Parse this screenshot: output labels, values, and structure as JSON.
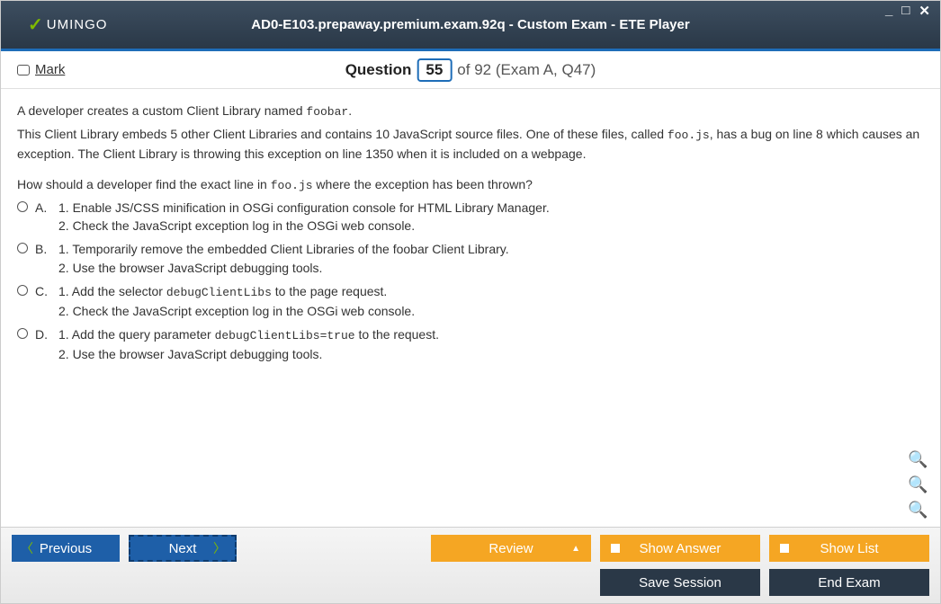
{
  "logo": {
    "brand": "UMINGO"
  },
  "title": "AD0-E103.prepaway.premium.exam.92q - Custom Exam - ETE Player",
  "header": {
    "mark_label": "Mark",
    "question_word": "Question",
    "number": "55",
    "of_text": "of 92 (Exam A, Q47)"
  },
  "question": {
    "line1_a": "A developer creates a custom Client Library named ",
    "line1_code": "foobar",
    "line1_b": ".",
    "line2_a": "This Client Library embeds 5 other Client Libraries and contains 10 JavaScript source files. One of these files, called ",
    "line2_code": "foo.js",
    "line2_b": ", has a bug on line 8 which causes an exception. The Client Library is throwing this exception on line 1350 when it is included on a webpage.",
    "prompt_a": "How should a developer find the exact line in ",
    "prompt_code": "foo.js",
    "prompt_b": " where the exception has been thrown?"
  },
  "options": {
    "A": {
      "label": "A.",
      "l1": "1. Enable JS/CSS minification in OSGi configuration console for HTML Library Manager.",
      "l2": "2. Check the JavaScript exception log in the OSGi web console."
    },
    "B": {
      "label": "B.",
      "l1": "1. Temporarily remove the embedded Client Libraries of the foobar Client Library.",
      "l2": "2. Use the browser JavaScript debugging tools."
    },
    "C": {
      "label": "C.",
      "l1a": "1. Add the selector ",
      "l1code": "debugClientLibs",
      "l1b": " to the page request.",
      "l2": "2. Check the JavaScript exception log in the OSGi web console."
    },
    "D": {
      "label": "D.",
      "l1a": "1. Add the query parameter ",
      "l1code": "debugClientLibs=true",
      "l1b": " to the request.",
      "l2": "2. Use the browser JavaScript debugging tools."
    }
  },
  "buttons": {
    "previous": "Previous",
    "next": "Next",
    "review": "Review",
    "show_answer": "Show Answer",
    "show_list": "Show List",
    "save_session": "Save Session",
    "end_exam": "End Exam"
  }
}
